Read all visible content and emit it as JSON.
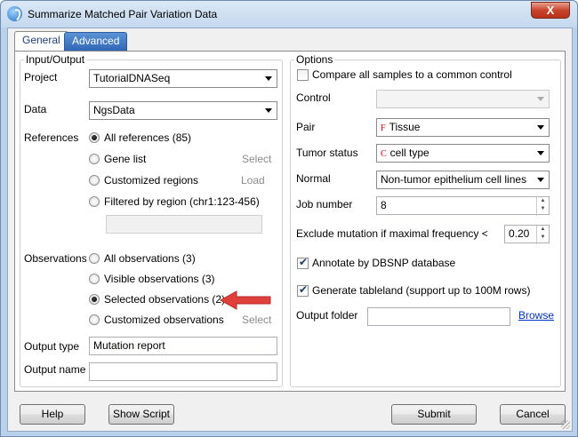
{
  "window": {
    "title": "Summarize Matched Pair Variation Data",
    "close_label": "X"
  },
  "tabs": [
    {
      "label": "General"
    },
    {
      "label": "Advanced"
    }
  ],
  "input_output": {
    "legend": "Input/Output",
    "project_label": "Project",
    "project_value": "TutorialDNASeq",
    "data_label": "Data",
    "data_value": "NgsData",
    "references_label": "References",
    "references": [
      {
        "label": "All references (85)",
        "selected": true,
        "action": ""
      },
      {
        "label": "Gene list",
        "selected": false,
        "action": "Select"
      },
      {
        "label": "Customized regions",
        "selected": false,
        "action": "Load"
      },
      {
        "label": "Filtered by region (chr1:123-456)",
        "selected": false,
        "action": ""
      }
    ],
    "region_value": "",
    "observations_label": "Observations",
    "observations": [
      {
        "label": "All observations (3)",
        "selected": false,
        "action": ""
      },
      {
        "label": "Visible observations (3)",
        "selected": false,
        "action": ""
      },
      {
        "label": "Selected observations (2)",
        "selected": true,
        "action": ""
      },
      {
        "label": "Customized observations",
        "selected": false,
        "action": "Select"
      }
    ],
    "output_type_label": "Output type",
    "output_type_value": "Mutation report",
    "output_name_label": "Output name",
    "output_name_value": ""
  },
  "options": {
    "legend": "Options",
    "compare_label": "Compare all samples to a common control",
    "compare_checked": false,
    "control_label": "Control",
    "control_value": "",
    "pair_label": "Pair",
    "pair_glyph": "F",
    "pair_value": "Tissue",
    "tumor_label": "Tumor status",
    "tumor_glyph": "C",
    "tumor_value": "cell type",
    "normal_label": "Normal",
    "normal_value": "Non-tumor epithelium cell lines",
    "job_label": "Job number",
    "job_value": "8",
    "exclude_label": "Exclude mutation if maximal frequency <",
    "exclude_value": "0.20",
    "annotate_label": "Annotate by DBSNP database",
    "annotate_checked": true,
    "tableland_label": "Generate tableland (support up to 100M rows)",
    "tableland_checked": true,
    "output_folder_label": "Output folder",
    "output_folder_value": "",
    "browse_label": "Browse"
  },
  "buttons": {
    "help": "Help",
    "show_script": "Show Script",
    "submit": "Submit",
    "cancel": "Cancel"
  },
  "colors": {
    "annotation_arrow": "#e0403a",
    "tab_active_text": "#1a3f8a",
    "link": "#0033cc"
  }
}
